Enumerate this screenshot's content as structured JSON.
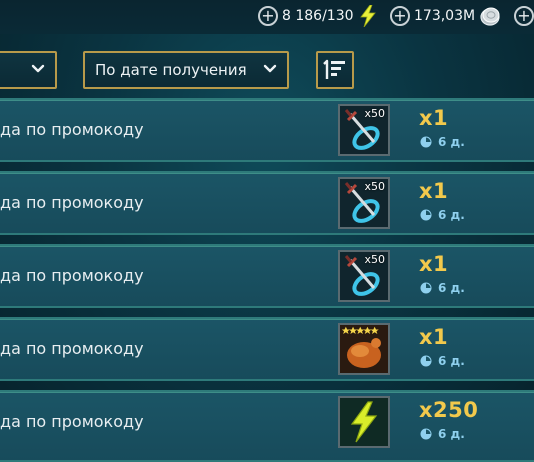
{
  "resources": {
    "energy": {
      "value": "8 186/130",
      "icon": "lightning-icon"
    },
    "silver": {
      "value": "173,03M",
      "icon": "silver-coin-icon"
    },
    "gems": {
      "icon": "plus-icon"
    }
  },
  "filters": {
    "left_dropdown_value": "",
    "sort_dropdown_value": "По дате получения",
    "sort_button_icon": "sort-order-icon"
  },
  "rows": [
    {
      "label": "да по промокоду",
      "tile_icon": "sword-ring-icon",
      "tile_count": "x50",
      "quantity": "x1",
      "timer": "6 д."
    },
    {
      "label": "да по промокоду",
      "tile_icon": "sword-ring-icon",
      "tile_count": "x50",
      "quantity": "x1",
      "timer": "6 д."
    },
    {
      "label": "да по промокоду",
      "tile_icon": "sword-ring-icon",
      "tile_count": "x50",
      "quantity": "x1",
      "timer": "6 д."
    },
    {
      "label": "да по промокоду",
      "tile_icon": "chicken-icon",
      "tile_count": "",
      "quantity": "x1",
      "timer": "6 д."
    },
    {
      "label": "да по промокоду",
      "tile_icon": "energy-bolt-icon",
      "tile_count": "",
      "quantity": "x250",
      "timer": "6 д."
    }
  ],
  "colors": {
    "quantity": "#f2c94c",
    "timer": "#8fd0ee",
    "gold_border": "#b89a4a",
    "row_border": "#2e7a7a"
  }
}
